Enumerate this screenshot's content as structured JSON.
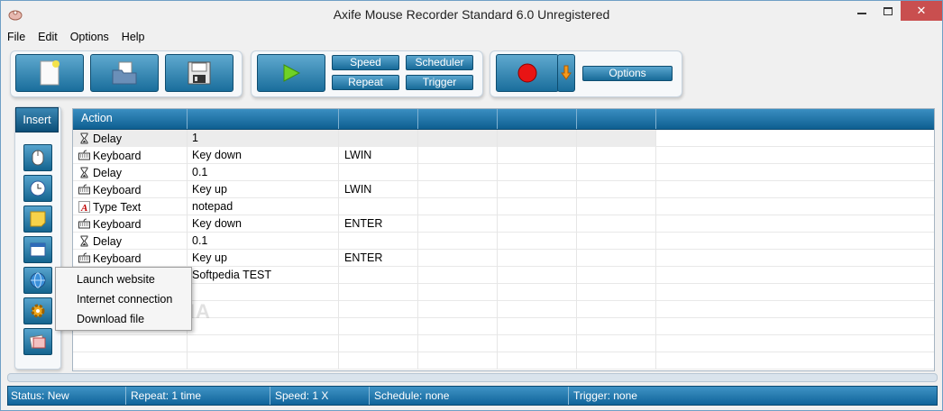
{
  "window": {
    "title": "Axife Mouse Recorder Standard 6.0 Unregistered",
    "close_label": "✕"
  },
  "menu": [
    "File",
    "Edit",
    "Options",
    "Help"
  ],
  "toolbar": {
    "speed": "Speed",
    "repeat": "Repeat",
    "scheduler": "Scheduler",
    "trigger": "Trigger",
    "options": "Options"
  },
  "sidebar": {
    "insert_label": "Insert"
  },
  "grid": {
    "headers": [
      "Action",
      "",
      "",
      "",
      "",
      "",
      ""
    ],
    "rows": [
      {
        "icon": "hourglass-icon",
        "action": "Delay",
        "param1": "1",
        "param2": ""
      },
      {
        "icon": "keyboard-icon",
        "action": "Keyboard",
        "param1": "Key down",
        "param2": "LWIN"
      },
      {
        "icon": "hourglass-icon",
        "action": "Delay",
        "param1": "0.1",
        "param2": ""
      },
      {
        "icon": "keyboard-icon",
        "action": "Keyboard",
        "param1": "Key up",
        "param2": "LWIN"
      },
      {
        "icon": "type-text-icon",
        "action": "Type Text",
        "param1": "notepad",
        "param2": ""
      },
      {
        "icon": "keyboard-icon",
        "action": "Keyboard",
        "param1": "Key down",
        "param2": "ENTER"
      },
      {
        "icon": "hourglass-icon",
        "action": "Delay",
        "param1": "0.1",
        "param2": ""
      },
      {
        "icon": "keyboard-icon",
        "action": "Keyboard",
        "param1": "Key up",
        "param2": "ENTER"
      },
      {
        "icon": "",
        "action": "",
        "param1": "Softpedia TEST",
        "param2": ""
      }
    ]
  },
  "popup": {
    "items": [
      "Launch website",
      "Internet connection",
      "Download file"
    ]
  },
  "watermark": "SOFTPEDIA",
  "status": {
    "status": "Status: New",
    "repeat": "Repeat: 1 time",
    "speed": "Speed: 1 X",
    "schedule": "Schedule: none",
    "trigger": "Trigger: none"
  }
}
